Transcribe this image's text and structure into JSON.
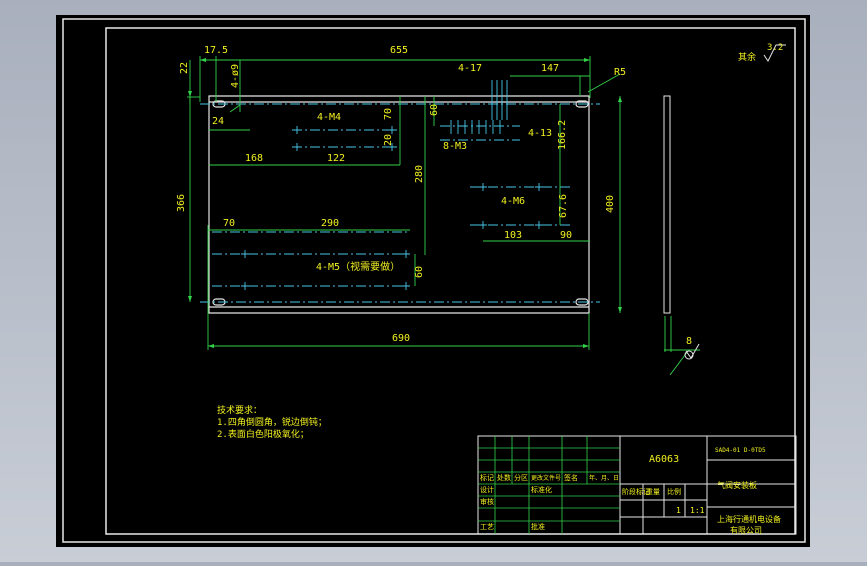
{
  "dims": {
    "d17_5": "17.5",
    "d655": "655",
    "d22": "22",
    "d4_phi9": "4-ø9",
    "d4_17": "4-17",
    "d147": "147",
    "dR5": "R5",
    "d24": "24",
    "d4_M4": "4-M4",
    "d60": "60",
    "d70": "70",
    "d20": "20",
    "d8_M3": "8-M3",
    "d4_13": "4-13",
    "d166_2": "166.2",
    "d168": "168",
    "d122": "122",
    "d366": "366",
    "d280": "280",
    "d4_M6": "4-M6",
    "d67_6": "67.6",
    "d400": "400",
    "d103": "103",
    "d90": "90",
    "d70b": "70",
    "d290": "290",
    "d4_M5": "4-M5（视需要做）",
    "d60b": "60",
    "d690": "690",
    "d8": "8"
  },
  "roughness": {
    "label": "其余",
    "value": "3.2"
  },
  "tech_notes": {
    "title": "技术要求：",
    "line1": "1.四角倒圆角，锐边倒钝；",
    "line2": "2.表面白色阳极氧化；"
  },
  "title_block": {
    "material": "A6063",
    "drawing_no": "SAD4-01 D-0TD5",
    "part_name": "气阀安装板",
    "company_line1": "上海行通机电设备",
    "company_line2": "有限公司",
    "scale_qty": "1",
    "scale": "1:1",
    "row_labels": [
      "标记",
      "处数",
      "分区",
      "更改文件号",
      "签名",
      "年、月、日"
    ],
    "left_labels": [
      "设计",
      "审核",
      "工艺"
    ],
    "left_labels2": [
      "标准化",
      "批准"
    ],
    "stage_labels": [
      "阶段标记",
      "重量",
      "比例"
    ]
  }
}
